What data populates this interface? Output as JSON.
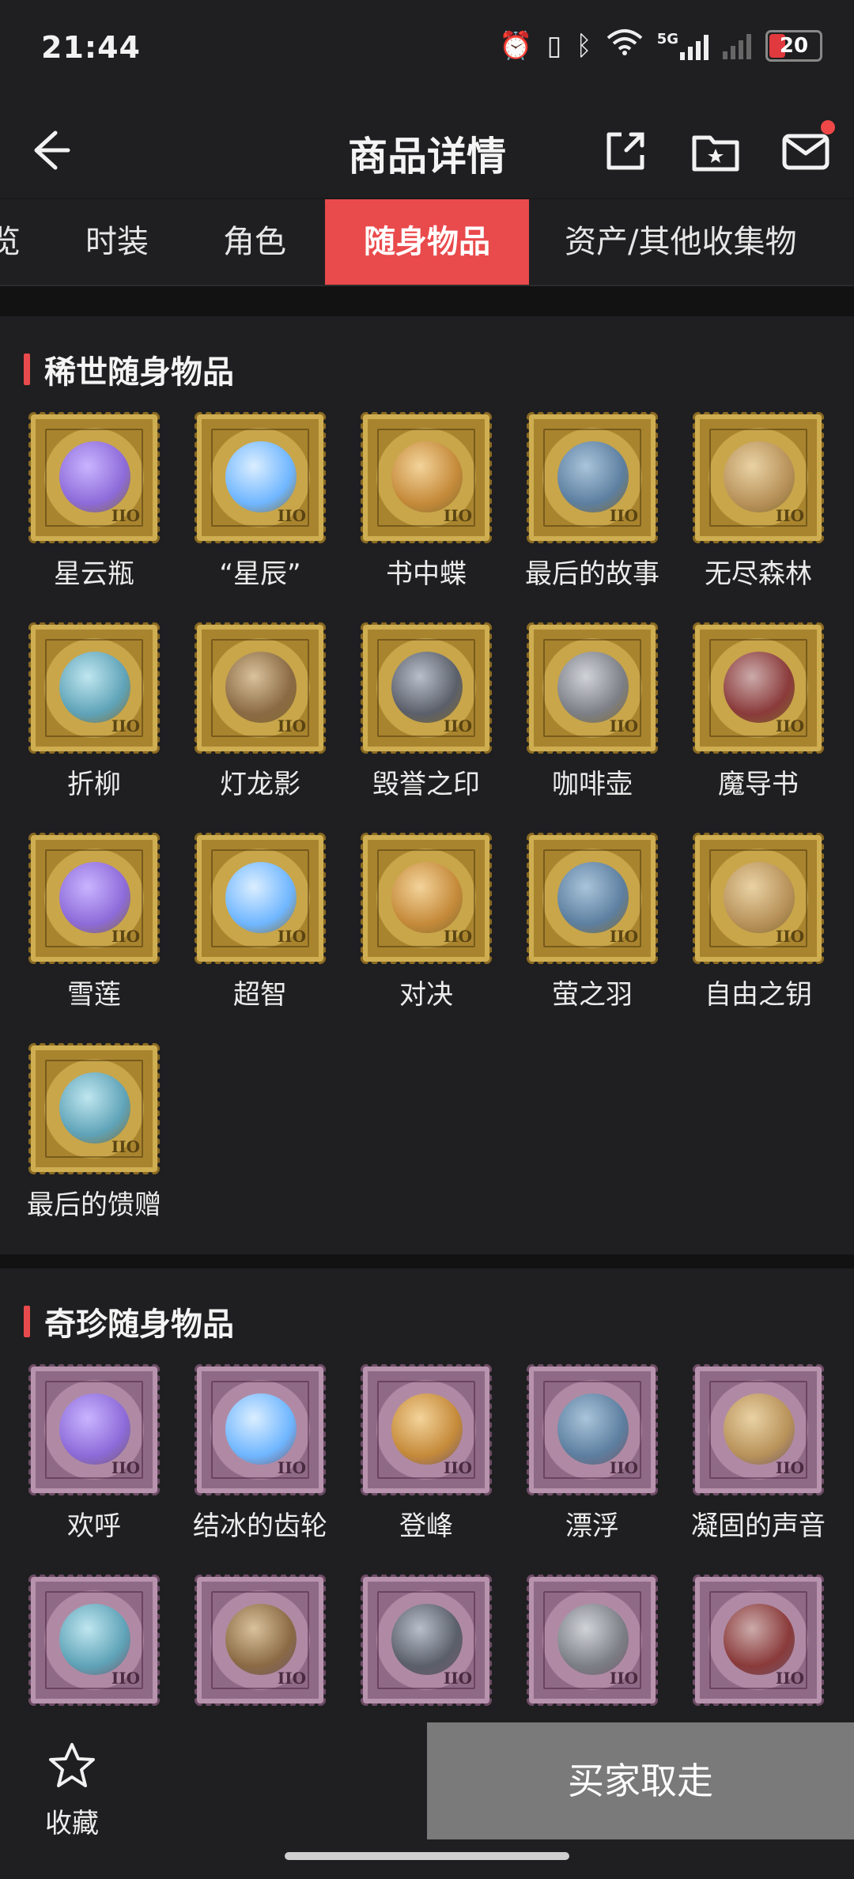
{
  "status_bar": {
    "time": "21:44",
    "battery": "20",
    "network": "5G"
  },
  "header": {
    "title": "商品详情"
  },
  "tabs": [
    {
      "label": "览"
    },
    {
      "label": "时装"
    },
    {
      "label": "角色"
    },
    {
      "label": "随身物品",
      "active": true
    },
    {
      "label": "资产/其他收集物"
    }
  ],
  "sections": [
    {
      "title": "稀世随身物品",
      "items": [
        "星云瓶",
        "“星辰”",
        "书中蝶",
        "最后的故事",
        "无尽森林",
        "折柳",
        "灯龙影",
        "毁誉之印",
        "咖啡壶",
        "魔导书",
        "雪莲",
        "超智",
        "对决",
        "萤之羽",
        "自由之钥",
        "最后的馈赠"
      ]
    },
    {
      "title": "奇珍随身物品",
      "items": [
        "欢呼",
        "结冰的齿轮",
        "登峰",
        "漂浮",
        "凝固的声音",
        "",
        "",
        "",
        "",
        ""
      ]
    }
  ],
  "stamp_mark": "IIO",
  "bottom_bar": {
    "favorite_label": "收藏",
    "buy_label": "买家取走"
  },
  "colors": {
    "accent": "#e94a4c",
    "background": "#1f1f21",
    "buy_button": "#7a7a7a"
  }
}
